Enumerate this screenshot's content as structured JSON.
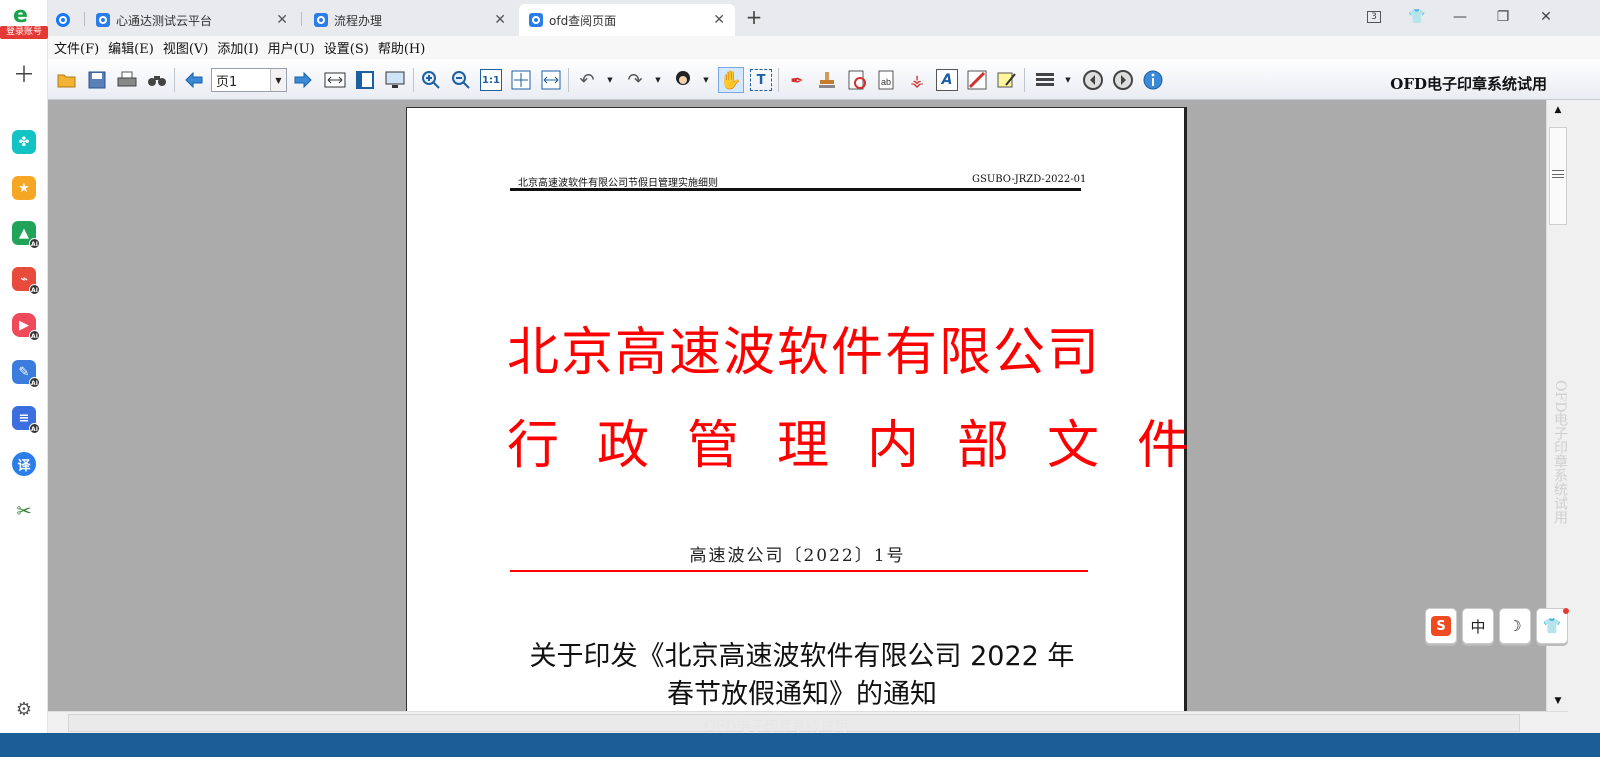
{
  "rail": {
    "logo_badge": "登录账号",
    "items": [
      {
        "name": "add",
        "icon": "plus-icon"
      },
      {
        "name": "tools",
        "icon": "clover-icon",
        "color": "#13c2c2"
      },
      {
        "name": "favorites",
        "icon": "star-icon",
        "color": "#f5a623"
      },
      {
        "name": "ai-image",
        "icon": "image-ai-icon",
        "color": "#22a35a"
      },
      {
        "name": "ai-pdf",
        "icon": "pdf-ai-icon",
        "color": "#e84a3c"
      },
      {
        "name": "ai-video",
        "icon": "video-ai-icon",
        "color": "#f04a5a"
      },
      {
        "name": "ai-write",
        "icon": "write-ai-icon",
        "color": "#3b7ddd"
      },
      {
        "name": "ai-doc",
        "icon": "doc-ai-icon",
        "color": "#3b6fe0"
      },
      {
        "name": "translate",
        "icon": "translate-icon",
        "color": "#2b7de9",
        "label": "译"
      },
      {
        "name": "scissors",
        "icon": "scissors-icon",
        "color": "#2e7d32"
      },
      {
        "name": "settings",
        "icon": "gear-icon"
      }
    ]
  },
  "tabs": [
    {
      "title": "心通达测试云平台",
      "active": false
    },
    {
      "title": "流程办理",
      "active": false
    },
    {
      "title": "ofd查阅页面",
      "active": true
    }
  ],
  "new_tab_label": "+",
  "window": {
    "tab_count": "3"
  },
  "menu": [
    "文件(F)",
    "编辑(E)",
    "视图(V)",
    "添加(I)",
    "用户(U)",
    "设置(S)",
    "帮助(H)"
  ],
  "toolbar": {
    "page_label": "页1",
    "trial_label": "OFD电子印章系统试用"
  },
  "document": {
    "header_left": "北京高速波软件有限公司节假日管理实施细则",
    "header_right": "GSUBO-JRZD-2022-01",
    "title_line1": "北京高速波软件有限公司",
    "title_line2": "行政管理内部文件",
    "number": "高速波公司〔2022〕1号",
    "subject_line1": "关于印发《北京高速波软件有限公司 2022 年",
    "subject_line2": "春节放假通知》的通知",
    "title_color": "#ff0000"
  },
  "watermark": "OFD电子印章系统试用",
  "ime": {
    "mode": "中"
  }
}
